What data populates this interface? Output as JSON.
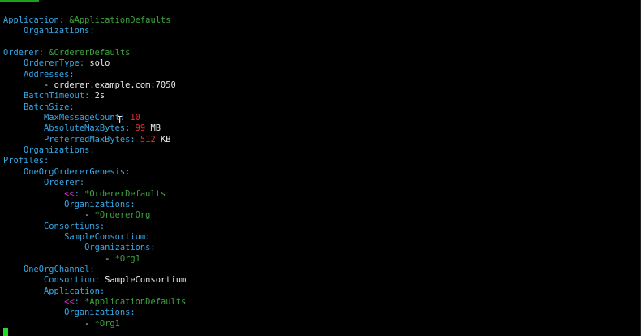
{
  "terminal": {
    "lines": [
      {
        "indent": "",
        "key": "Application",
        "colon": ":",
        "anchor": " &ApplicationDefaults"
      },
      {
        "indent": "    ",
        "key": "Organizations",
        "colon": ":"
      },
      {
        "indent": ""
      },
      {
        "indent": "",
        "key": "Orderer",
        "colon": ":",
        "anchor": " &OrdererDefaults"
      },
      {
        "indent": "    ",
        "key": "OrdererType",
        "colon": ":",
        "value": " solo"
      },
      {
        "indent": "    ",
        "key": "Addresses",
        "colon": ":"
      },
      {
        "indent": "        ",
        "dash": "- ",
        "value": "orderer.example.com:7050"
      },
      {
        "indent": "    ",
        "key": "BatchTimeout",
        "colon": ":",
        "value": " 2s"
      },
      {
        "indent": "    ",
        "key": "BatchSize",
        "colon": ":"
      },
      {
        "indent": "        ",
        "key": "MaxMessageCount",
        "colon": ":",
        "number": " 10"
      },
      {
        "indent": "        ",
        "key": "AbsoluteMaxBytes",
        "colon": ":",
        "number": " 99",
        "value": " MB"
      },
      {
        "indent": "        ",
        "key": "PreferredMaxBytes",
        "colon": ":",
        "number": " 512",
        "value": " KB"
      },
      {
        "indent": "    ",
        "key": "Organizations",
        "colon": ":"
      },
      {
        "indent": "",
        "key": "Profiles",
        "colon": ":"
      },
      {
        "indent": "    ",
        "key": "OneOrgOrdererGenesis",
        "colon": ":"
      },
      {
        "indent": "        ",
        "key": "Orderer",
        "colon": ":"
      },
      {
        "indent": "            ",
        "merge": "<<",
        "colon": ":",
        "anchor": " *OrdererDefaults"
      },
      {
        "indent": "            ",
        "key": "Organizations",
        "colon": ":"
      },
      {
        "indent": "                ",
        "dash": "- ",
        "anchor": "*OrdererOrg"
      },
      {
        "indent": "        ",
        "key": "Consortiums",
        "colon": ":"
      },
      {
        "indent": "            ",
        "key": "SampleConsortium",
        "colon": ":"
      },
      {
        "indent": "                ",
        "key": "Organizations",
        "colon": ":"
      },
      {
        "indent": "                    ",
        "dash": "- ",
        "anchor": "*Org1"
      },
      {
        "indent": "    ",
        "key": "OneOrgChannel",
        "colon": ":"
      },
      {
        "indent": "        ",
        "key": "Consortium",
        "colon": ":",
        "value": " SampleConsortium"
      },
      {
        "indent": "        ",
        "key": "Application",
        "colon": ":"
      },
      {
        "indent": "            ",
        "merge": "<<",
        "colon": ":",
        "anchor": " *ApplicationDefaults"
      },
      {
        "indent": "            ",
        "key": "Organizations",
        "colon": ":"
      },
      {
        "indent": "                ",
        "dash": "- ",
        "anchor": "*Org1"
      }
    ]
  },
  "colors": {
    "background": "#000000",
    "key": "#35a8e6",
    "anchor": "#3fa23f",
    "merge": "#d230c6",
    "number": "#e03030",
    "text": "#e8e8e8",
    "cursor": "#26d926"
  }
}
